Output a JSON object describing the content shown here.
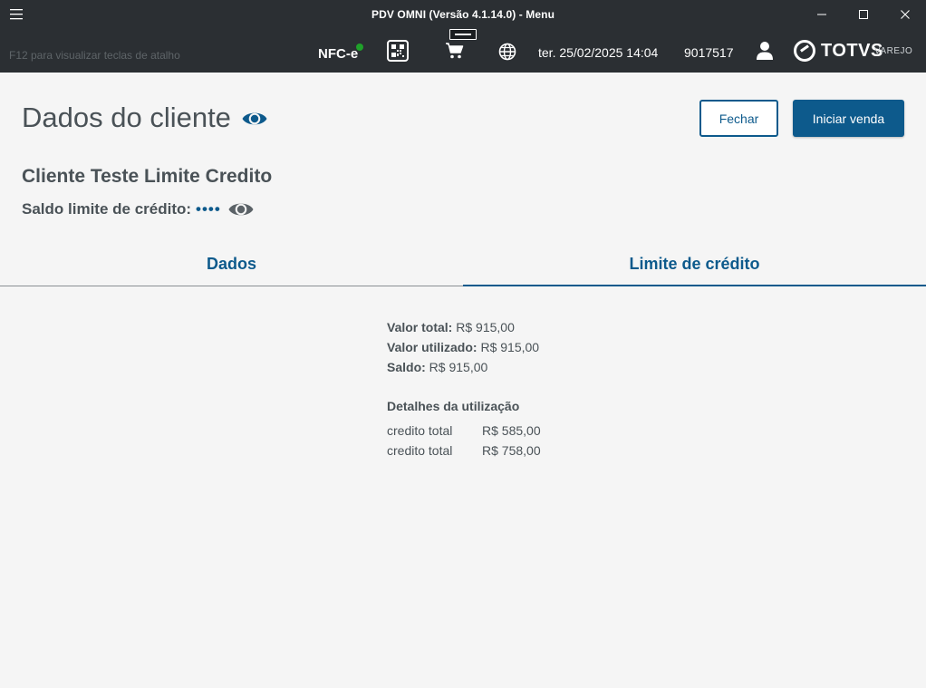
{
  "window": {
    "title": "PDV OMNI (Versão 4.1.14.0) - Menu"
  },
  "toolbar": {
    "hint": "F12 para visualizar teclas de atalho",
    "nfce_label": "NFC-e",
    "nfce_status_color": "#1fa12a",
    "datetime": "ter. 25/02/2025 14:04",
    "user_id": "9017517",
    "logo_brand": "TOTVS",
    "logo_sub": "VAREJO"
  },
  "header": {
    "page_title": "Dados do cliente",
    "close_label": "Fechar",
    "start_sale_label": "Iniciar venda"
  },
  "client": {
    "name": "Cliente Teste Limite Credito",
    "credit_label": "Saldo limite de crédito:",
    "credit_masked": "••••"
  },
  "tabs": [
    {
      "label": "Dados",
      "active": false
    },
    {
      "label": "Limite de crédito",
      "active": true
    }
  ],
  "credit": {
    "total_label": "Valor total:",
    "total_value": "R$ 915,00",
    "used_label": "Valor utilizado:",
    "used_value": "R$ 915,00",
    "balance_label": "Saldo:",
    "balance_value": "R$ 915,00",
    "details_title": "Detalhes da utilização",
    "details": [
      {
        "name": "credito total",
        "value": "R$ 585,00"
      },
      {
        "name": "credito total",
        "value": "R$ 758,00"
      }
    ]
  },
  "colors": {
    "accent": "#0d5a8c",
    "titlebar": "#2b2f33",
    "text": "#4a5257"
  }
}
